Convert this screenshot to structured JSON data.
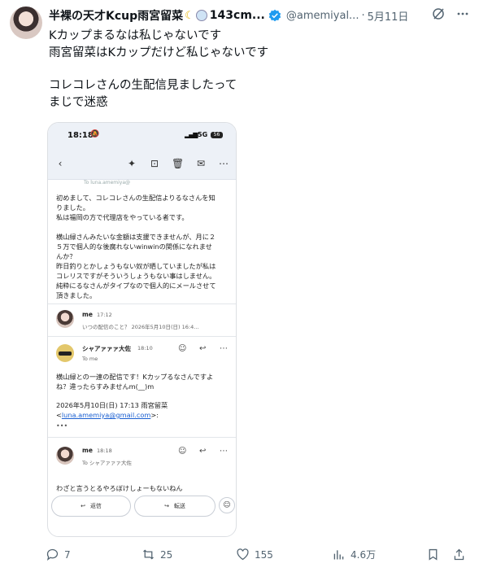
{
  "tweet": {
    "display_name": "半裸の天才Kcup雨宮留菜",
    "name_suffix": "143cm...",
    "handle": "@amemiyal...",
    "timestamp": "5月11日",
    "separator": "·",
    "lines": [
      "Kカップまるなは私じゃないです",
      "雨宮留菜はKカップだけど私じゃないです",
      "",
      "コレコレさんの生配信見ましたって",
      "まじで迷惑"
    ],
    "counts": {
      "replies": "7",
      "reposts": "25",
      "likes": "155",
      "views": "4.6万"
    }
  },
  "phone": {
    "status": {
      "time": "18:18",
      "network": "5G",
      "battery": "56"
    },
    "hidden_header": "To luna.amemiya@",
    "email_body": [
      "初めまして、コレコレさんの生配信よりるなさんを知",
      "りました。",
      "私は福岡の方で代理店をやっている者です。",
      "",
      "横山緑さんみたいな金額は支援できませんが、月に２",
      "５万で個人的な後腐れないwinwinの関係になれませ",
      "んか？",
      "昨日釣りとかしょうもない奴が晒していましたが私は",
      "コレリスですがそういうしょうもない事はしません。",
      "純粋にるなさんがタイプなので個人的にメールさせて",
      "頂きました。"
    ],
    "msg1": {
      "sender": "me",
      "time": "17:12",
      "preview": "いつの配信のこと？ 2026年5月10日(日) 16:4..."
    },
    "msg2": {
      "sender": "シャアァァァ大佐",
      "time": "18:10",
      "to": "To me",
      "body": "横山緑との一連の配信です！Kカップるなさんですよ\nね？違ったらすみませんm(__)m",
      "quote_header": "2026年5月10日(日) 17:13 雨宮留菜",
      "quote_link": "luna.amemiya@gmail.com",
      "quote_prefix": "<",
      "quote_suffix": ">:",
      "ellipsis": "•••"
    },
    "msg3": {
      "sender": "me",
      "time": "18:18",
      "to": "To シャアァァァ大佐",
      "body": "わざと言うとるやろぼけしょーもないねん"
    },
    "buttons": {
      "reply": "返信",
      "forward": "転送"
    }
  }
}
